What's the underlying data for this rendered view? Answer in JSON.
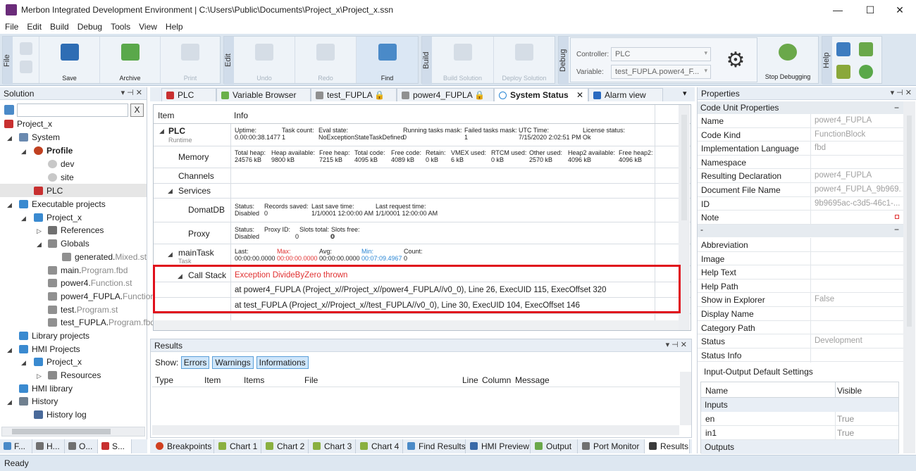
{
  "window": {
    "title": "Merbon Integrated Development Environment | C:\\Users\\Public\\Documents\\Project_x\\Project_x.ssn",
    "minimize": "—",
    "maximize": "☐",
    "close": "✕"
  },
  "menu": [
    "File",
    "Edit",
    "Build",
    "Debug",
    "Tools",
    "View",
    "Help"
  ],
  "ribbon": {
    "groups": {
      "file": "File",
      "edit": "Edit",
      "build": "Build",
      "debug": "Debug",
      "help": "Help"
    },
    "file": {
      "save": "Save",
      "archive": "Archive",
      "print": "Print"
    },
    "edit": {
      "undo": "Undo",
      "redo": "Redo",
      "find": "Find"
    },
    "build": {
      "build_solution": "Build Solution",
      "deploy_solution": "Deploy Solution"
    },
    "debug": {
      "controller_label": "Controller:",
      "controller_value": "PLC",
      "variable_label": "Variable:",
      "variable_value": "test_FUPLA.power4_F...",
      "stop": "Stop Debugging"
    }
  },
  "solution": {
    "title": "Solution",
    "search_clear": "X",
    "items": [
      {
        "label": "Project_x",
        "suffix": ""
      },
      {
        "label": "System",
        "suffix": ""
      },
      {
        "label": "Profile",
        "suffix": ""
      },
      {
        "label": "dev",
        "suffix": ""
      },
      {
        "label": "site",
        "suffix": ""
      },
      {
        "label": "PLC",
        "suffix": ""
      },
      {
        "label": "Executable projects",
        "suffix": ""
      },
      {
        "label": "Project_x",
        "suffix": ""
      },
      {
        "label": "References",
        "suffix": ""
      },
      {
        "label": "Globals",
        "suffix": ""
      },
      {
        "label": "generated.",
        "suffix": "Mixed.st"
      },
      {
        "label": "main.",
        "suffix": "Program.fbd"
      },
      {
        "label": "power4.",
        "suffix": "Function.st"
      },
      {
        "label": "power4_FUPLA.",
        "suffix": "Function"
      },
      {
        "label": "test.",
        "suffix": "Program.st"
      },
      {
        "label": "test_FUPLA.",
        "suffix": "Program.fbd"
      },
      {
        "label": "Library projects",
        "suffix": ""
      },
      {
        "label": "HMI Projects",
        "suffix": ""
      },
      {
        "label": "Project_x",
        "suffix": ""
      },
      {
        "label": "Resources",
        "suffix": ""
      },
      {
        "label": "HMI library",
        "suffix": ""
      },
      {
        "label": "History",
        "suffix": ""
      },
      {
        "label": "History log",
        "suffix": ""
      }
    ],
    "tabs": [
      "F...",
      "H...",
      "O...",
      "S..."
    ]
  },
  "doc_tabs": [
    "PLC",
    "Variable Browser",
    "test_FUPLA",
    "power4_FUPLA",
    "System Status",
    "Alarm view"
  ],
  "system_status": {
    "headers": {
      "item": "Item",
      "info": "Info"
    },
    "plc": {
      "name": "PLC",
      "sub": "Runtime",
      "fields": [
        {
          "label": "Uptime:",
          "value": "0.00:00:38.1477"
        },
        {
          "label": "Task count:",
          "value": "1"
        },
        {
          "label": "Eval state:",
          "value": "NoExceptionStateTaskDefined"
        },
        {
          "label": "Running tasks mask:",
          "value": "0"
        },
        {
          "label": "Failed tasks mask:",
          "value": "1"
        },
        {
          "label": "UTC Time:",
          "value": "7/15/2020 2:02:51 PM"
        },
        {
          "label": "License status:",
          "value": "Ok"
        }
      ]
    },
    "memory": {
      "name": "Memory",
      "fields": [
        {
          "label": "Total heap:",
          "value": "24576 kB"
        },
        {
          "label": "Heap available:",
          "value": "9800 kB"
        },
        {
          "label": "Free heap:",
          "value": "7215 kB"
        },
        {
          "label": "Total code:",
          "value": "4095 kB"
        },
        {
          "label": "Free code:",
          "value": "4089 kB"
        },
        {
          "label": "Retain:",
          "value": "0 kB"
        },
        {
          "label": "VMEX used:",
          "value": "6 kB"
        },
        {
          "label": "RTCM used:",
          "value": "0 kB"
        },
        {
          "label": "Other used:",
          "value": "2570 kB"
        },
        {
          "label": "Heap2 available:",
          "value": "4096 kB"
        },
        {
          "label": "Free heap2:",
          "value": "4096 kB"
        }
      ]
    },
    "channels": "Channels",
    "services": "Services",
    "domatdb": {
      "name": "DomatDB",
      "fields": [
        {
          "label": "Status:",
          "value": "Disabled"
        },
        {
          "label": "Records saved:",
          "value": "0"
        },
        {
          "label": "Last save time:",
          "value": "1/1/0001 12:00:00 AM"
        },
        {
          "label": "Last request time:",
          "value": "1/1/0001 12:00:00 AM"
        }
      ]
    },
    "proxy": {
      "name": "Proxy",
      "fields": [
        {
          "label": "Status:",
          "value": "Disabled"
        },
        {
          "label": "Proxy ID:",
          "value": "0"
        },
        {
          "label": "Slots total:",
          "value": "0"
        },
        {
          "label": "Slots free:",
          "value": "0"
        }
      ]
    },
    "maintask": {
      "name": "mainTask",
      "sub": "Task",
      "fields": [
        {
          "label": "Last:",
          "value": "00:00:00.0000"
        },
        {
          "label": "Max:",
          "value": "00:00:00.0000"
        },
        {
          "label": "Avg:",
          "value": "00:00:00.0000"
        },
        {
          "label": "Min:",
          "value": "00:07:09.4967"
        },
        {
          "label": "Count:",
          "value": "0"
        }
      ]
    },
    "callstack": {
      "name": "Call Stack",
      "exception": "Exception DivideByZero thrown",
      "frames": [
        "at power4_FUPLA (Project_x//Project_x//power4_FUPLA//v0_0), Line 26, ExecUID 115, ExecOffset 320",
        "at test_FUPLA (Project_x//Project_x//test_FUPLA//v0_0), Line 30, ExecUID 104, ExecOffset 146"
      ]
    }
  },
  "results": {
    "title": "Results",
    "show": "Show:",
    "filters": [
      "Errors",
      "Warnings",
      "Informations"
    ],
    "columns": [
      "Type",
      "Item",
      "Items",
      "File",
      "Line",
      "Column",
      "Message"
    ]
  },
  "bottom_tabs": [
    "Breakpoints",
    "Chart 1",
    "Chart 2",
    "Chart 3",
    "Chart 4",
    "Find Results",
    "HMI Preview",
    "Output",
    "Port Monitor",
    "Results"
  ],
  "properties": {
    "title": "Properties",
    "section": "Code Unit Properties",
    "rows": [
      {
        "name": "Name",
        "value": "power4_FUPLA"
      },
      {
        "name": "Code Kind",
        "value": "FunctionBlock"
      },
      {
        "name": "Implementation Language",
        "value": "fbd"
      },
      {
        "name": "Namespace",
        "value": ""
      },
      {
        "name": "Resulting Declaration",
        "value": "power4_FUPLA"
      },
      {
        "name": "Document File Name",
        "value": "power4_FUPLA_9b969..."
      },
      {
        "name": "ID",
        "value": "9b9695ac-c3d5-46c1-..."
      },
      {
        "name": "Note",
        "value": ""
      }
    ],
    "section2": "-",
    "rows2": [
      {
        "name": "Abbreviation",
        "value": ""
      },
      {
        "name": "Image",
        "value": ""
      },
      {
        "name": "Help Text",
        "value": ""
      },
      {
        "name": "Help Path",
        "value": ""
      },
      {
        "name": "Show in Explorer",
        "value": "False"
      },
      {
        "name": "Display Name",
        "value": ""
      },
      {
        "name": "Category Path",
        "value": ""
      },
      {
        "name": "Status",
        "value": "Development"
      },
      {
        "name": "Status Info",
        "value": ""
      }
    ],
    "io": {
      "title": "Input-Output Default Settings",
      "col_name": "Name",
      "col_visible": "Visible",
      "inputs": "Inputs",
      "rows": [
        {
          "name": "en",
          "visible": "True"
        },
        {
          "name": "in1",
          "visible": "True"
        }
      ],
      "outputs": "Outputs"
    }
  },
  "status": "Ready",
  "colors": {
    "accent": "#2a86d4",
    "error": "#e03030",
    "highlight": "#e0101c",
    "ribbon": "#dce6f0"
  }
}
